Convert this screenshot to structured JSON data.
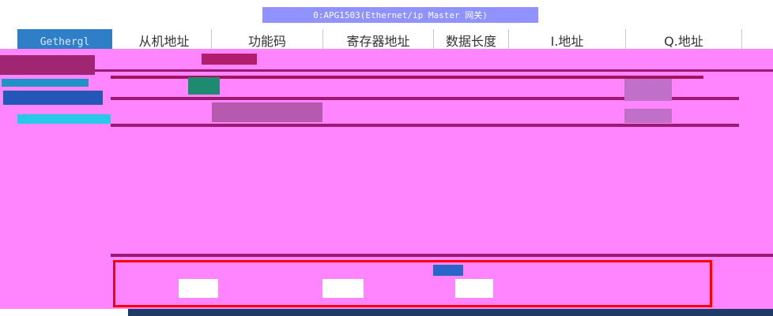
{
  "window": {
    "title": "0:APG1503(Ethernet/ip Master 网关)"
  },
  "sidebar": {
    "active_tab": "Gethergl"
  },
  "table": {
    "columns": [
      {
        "label": "从机地址"
      },
      {
        "label": "功能码"
      },
      {
        "label": "寄存器地址"
      },
      {
        "label": "数据长度"
      },
      {
        "label": "I.地址"
      },
      {
        "label": "Q.地址"
      }
    ]
  },
  "colors": {
    "title_bar": "#8f92ff",
    "tab_active": "#2f7fc8",
    "glitch_pink": "#ff85ff",
    "glitch_line": "#9c1873",
    "highlight_box": "#ff0000"
  }
}
